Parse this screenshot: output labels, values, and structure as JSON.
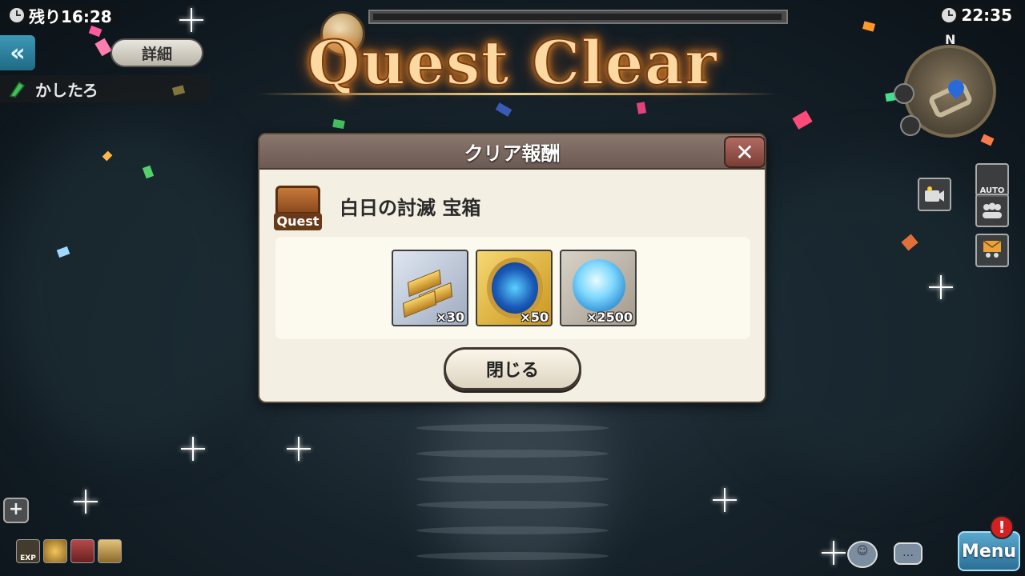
{
  "hud": {
    "time_remaining": "残り16:28",
    "clock": "22:35",
    "detail_button": "詳細",
    "player_name": "かしたろ",
    "back_button": "«",
    "compass_label": "N",
    "auto_label": "AUTO"
  },
  "banner": {
    "title": "Quest Clear"
  },
  "modal": {
    "title": "クリア報酬",
    "close_icon": "✕",
    "chest_label": "Quest",
    "reward_source": "白日の討滅 宝箱",
    "rewards": [
      {
        "icon": "gold-ingot-icon",
        "count": "×30"
      },
      {
        "icon": "gold-compass-orb-icon",
        "count": "×50"
      },
      {
        "icon": "blue-heart-icon",
        "count": "×2500"
      }
    ],
    "close_button": "閉じる"
  },
  "bottom": {
    "plus_button": "+",
    "buffs": [
      "EXP",
      "",
      "",
      ""
    ],
    "menu_button": "Menu",
    "alert_badge": "!"
  },
  "colors": {
    "title_glow": "#f39a2a",
    "modal_header": "#6b5a53",
    "menu_blue": "#2c6f96",
    "alert_red": "#d32020"
  }
}
